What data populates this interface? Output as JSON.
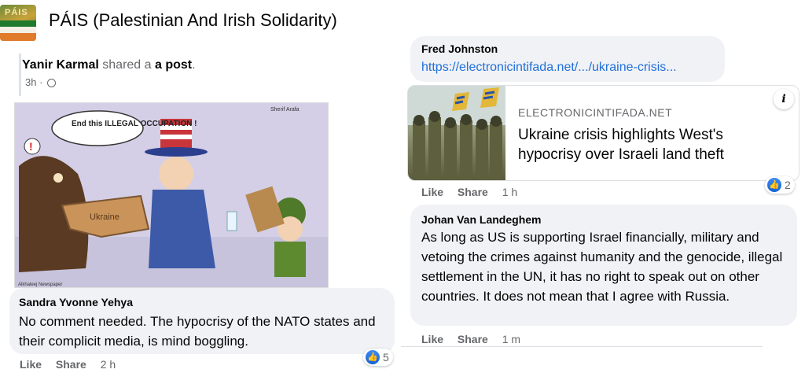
{
  "group": {
    "title": "PÁIS (Palestinian And Irish Solidarity)",
    "avatar_text": "PÁIS"
  },
  "left_post": {
    "sharer": "Yanir Karmal",
    "shared_a": "shared a",
    "post_word": "post",
    "time": "3h ·",
    "cartoon": {
      "speech": "End this ILLEGAL OCCUPATION !",
      "exclaim": "!",
      "ukraine_label": "Ukraine",
      "signature": "Sherif Arafa",
      "credit": "Alkhaleej Newspaper"
    },
    "comment": {
      "author": "Sandra Yvonne Yehya",
      "text": "No comment needed. The hypocrisy of the NATO states and their complicit media, is mind boggling.",
      "like": "Like",
      "share": "Share",
      "time": "2 h",
      "reaction_count": "5"
    }
  },
  "right_thread": {
    "comment1": {
      "author": "Fred Johnston",
      "link": "https://electronicintifada.net/.../ukraine-crisis..."
    },
    "link_card": {
      "domain": "ELECTRONICINTIFADA.NET",
      "title": "Ukraine crisis highlights West's hypocrisy over Israeli land theft",
      "info": "i"
    },
    "comment1_actions": {
      "like": "Like",
      "share": "Share",
      "time": "1 h",
      "reaction_count": "2"
    },
    "comment2": {
      "author": "Johan Van Landeghem",
      "text": "As long as US is supporting Israel financially, military and vetoing the crimes against humanity and the genocide, illegal settlement in the UN, it has no right to speak out on other countries. It does not mean that I agree with Russia."
    },
    "comment2_actions": {
      "like": "Like",
      "share": "Share",
      "time": "1 m"
    }
  },
  "colors": {
    "link": "#216fdb",
    "bubble": "#f0f2f5",
    "muted": "#65676b",
    "like_blue": "#1877f2"
  }
}
